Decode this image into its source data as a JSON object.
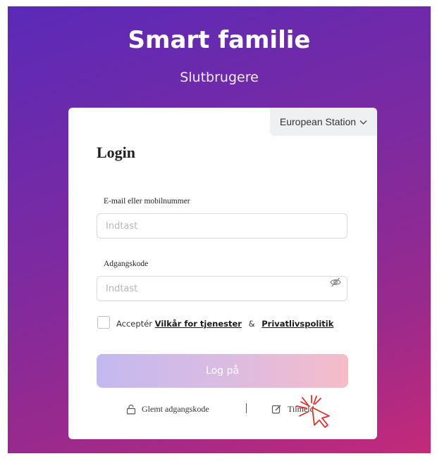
{
  "header": {
    "title": "Smart familie",
    "subtitle": "Slutbrugere"
  },
  "station": {
    "label": "European Station",
    "icon": "chevron-down-icon"
  },
  "login": {
    "heading": "Login",
    "email_label": "E-mail eller mobilnummer",
    "email_placeholder": "Indtast",
    "password_label": "Adgangskode",
    "password_placeholder": "Indtast",
    "password_icon": "eye-off-icon"
  },
  "terms": {
    "accept": "Acceptér",
    "service_terms": "Vilkår for tjenester",
    "and": "&",
    "privacy": "Privatlivspolitik",
    "checked": false
  },
  "buttons": {
    "login": "Log på",
    "forgot": "Glemt adgangskode",
    "register": "Tilmeld"
  },
  "colors": {
    "background_start": "#5a2ab8",
    "background_end": "#c42a78",
    "button_start": "#c4b9f0",
    "button_end": "#f6bcc9",
    "cursor": "#e0302a"
  }
}
